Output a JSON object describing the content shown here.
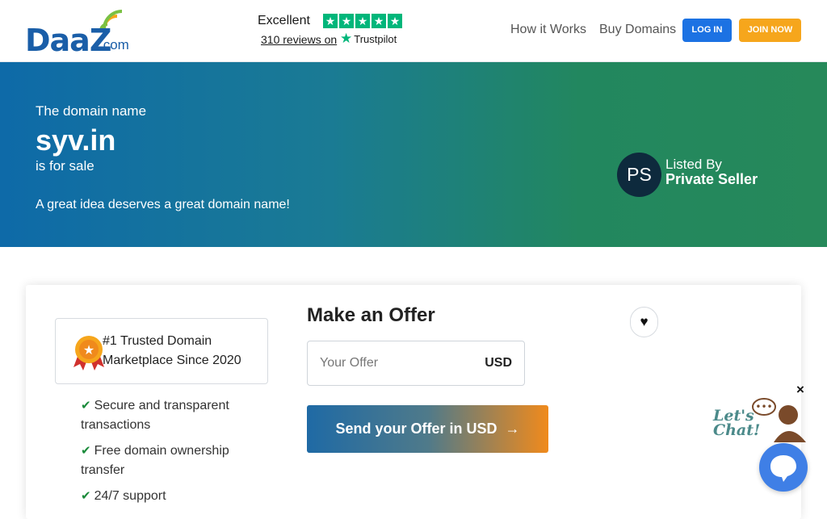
{
  "brand": {
    "name": "DaaZ",
    "suffix": ".com"
  },
  "trustpilot": {
    "rating_label": "Excellent",
    "reviews": "310 reviews on",
    "brand": "Trustpilot",
    "stars": 5
  },
  "nav": {
    "how_it_works": "How it Works",
    "buy_domains": "Buy Domains",
    "login": "LOG IN",
    "join": "JOIN NOW"
  },
  "hero": {
    "pre": "The domain name",
    "domain": "syv.in",
    "status": "is for sale",
    "tagline": "A great idea deserves a great domain name!"
  },
  "seller": {
    "initials": "PS",
    "listed_label": "Listed By",
    "name": "Private Seller"
  },
  "trust_badge": {
    "text": "#1 Trusted Domain Marketplace Since 2020"
  },
  "features": [
    "Secure and transparent transactions",
    "Free domain ownership transfer",
    "24/7 support"
  ],
  "offer": {
    "title": "Make an Offer",
    "placeholder": "Your Offer",
    "currency": "USD",
    "submit": "Send your Offer in USD"
  },
  "chat": {
    "label_line1": "Let's",
    "label_line2": "Chat!",
    "close": "×"
  },
  "colors": {
    "primary": "#1c72e3",
    "accent": "#f6a61c",
    "hero_start": "#0e6aa8",
    "hero_end": "#26895a",
    "trustpilot": "#00b67a"
  }
}
